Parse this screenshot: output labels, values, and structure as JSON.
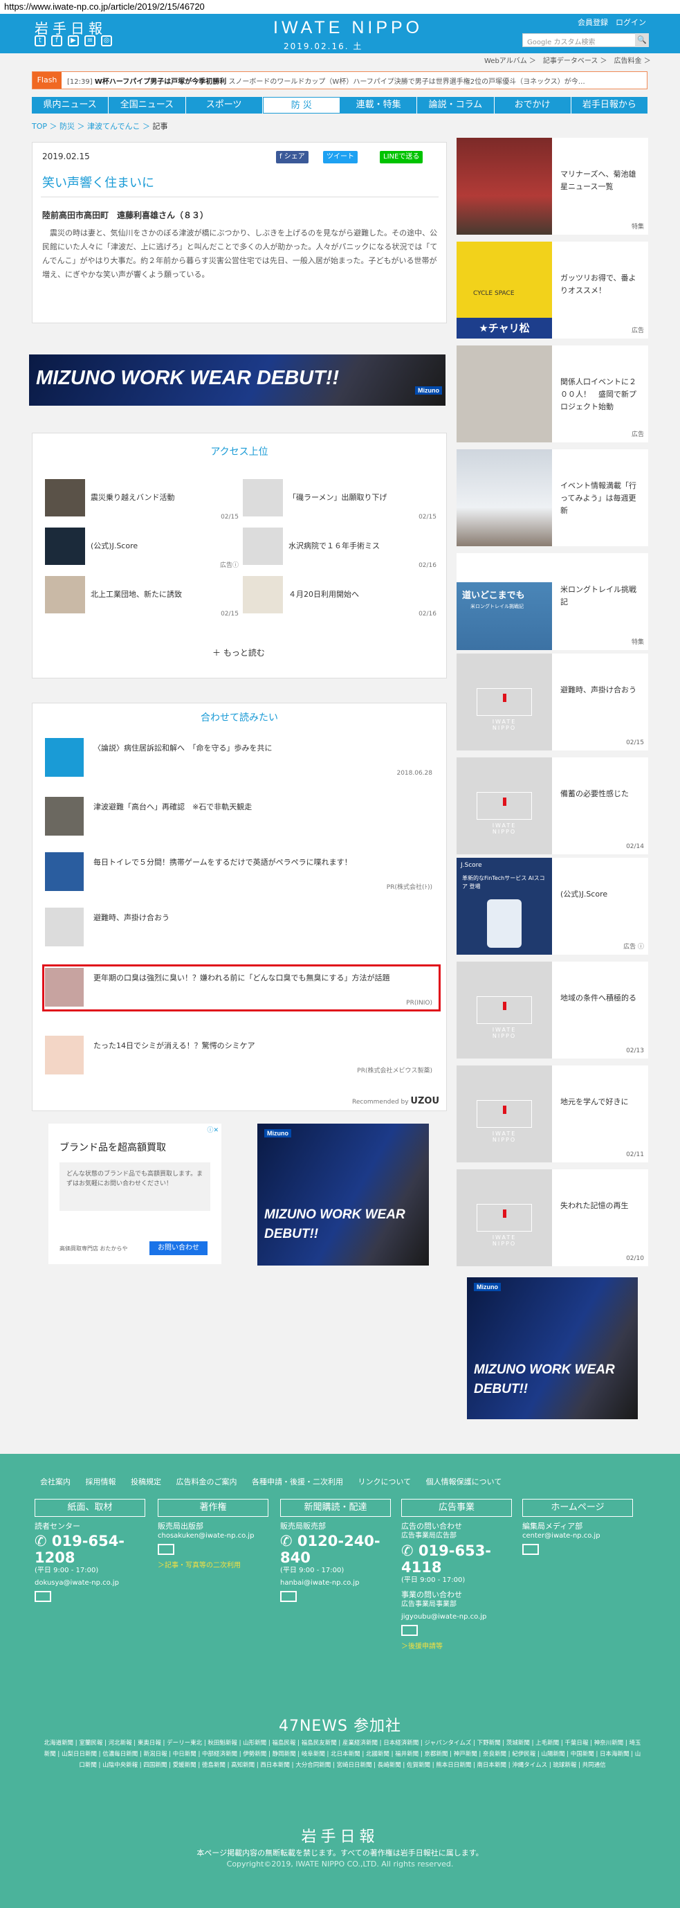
{
  "url": "https://www.iwate-np.co.jp/article/2019/2/15/46720",
  "header": {
    "logo": "岩手日報",
    "brand": "IWATE NIPPO",
    "date": "2019.02.16. 土",
    "links": "会員登録　ログイン",
    "search_placeholder": "Google カスタム検索",
    "search_btn": "🔍"
  },
  "toplinks": "Webアルバム ＞　記事データベース ＞　広告料金 ＞",
  "flash": {
    "label": "Flash",
    "time": "[12:39]",
    "headline": "W杯ハーフパイプ男子は戸塚が今季初勝利",
    "text": "スノーボードのワールドカップ（W杯）ハーフパイプ決勝で男子は世界選手権2位の戸塚優斗（ヨネックス）が今…"
  },
  "nav": [
    "県内ニュース",
    "全国ニュース",
    "スポーツ",
    "防 災",
    "連載・特集",
    "論説・コラム",
    "おでかけ",
    "岩手日報から"
  ],
  "breadcrumb": {
    "a": "TOP",
    "b": "防災",
    "c": "津波てんでんこ",
    "d": "記事",
    "sep": " ＞ "
  },
  "article": {
    "date": "2019.02.15",
    "share_fb": "f シェア",
    "share_tw": "ツイート",
    "share_line": "LINEで送る",
    "title": "笑い声響く住まいに",
    "author": "陸前高田市高田町　遠藤利喜雄さん（８３）",
    "body": "　震災の時は妻と、気仙川をさかのぼる津波が橋にぶつかり、しぶきを上げるのを見ながら避難した。その途中、公民館にいた人々に「津波だ、上に逃げろ」と叫んだことで多くの人が助かった。人々がパニックになる状況では「てんでんこ」がやはり大事だ。約２年前から暮らす災害公営住宅では先日、一般入居が始まった。子どもがいる世帯が増え、にぎやかな笑い声が響くよう願っている。"
  },
  "ad_banner_text": "MIZUNO WORK WEAR DEBUT!!",
  "mizuno_logo": "Mizuno",
  "ranking": {
    "title": "アクセス上位",
    "items": [
      {
        "title": "震災乗り越えバンド活動",
        "date": "02/15"
      },
      {
        "title": "「磯ラーメン」出願取り下げ",
        "date": "02/15"
      },
      {
        "title": "(公式)J.Score",
        "date": "広告ⓘ"
      },
      {
        "title": "水沢病院で１６年手術ミス",
        "date": "02/16"
      },
      {
        "title": "北上工業団地、新たに誘致",
        "date": "02/15"
      },
      {
        "title": "４月20日利用開始へ",
        "date": "02/16"
      }
    ],
    "more": "もっと読む"
  },
  "recommend": {
    "title": "合わせて読みたい",
    "items": [
      {
        "title": "〈論説〉病住居訴訟和解へ　「命を守る」歩みを共に",
        "meta": "2018.06.28"
      },
      {
        "title": "津波避難「高台へ」再確認　※石で非軌天観走",
        "meta": ""
      },
      {
        "title": "毎日トイレで５分間！携帯ゲームをするだけで英語がペラペラに喋れます！",
        "meta": "PR(株式会社(ﾄ))"
      },
      {
        "title": "避難時、声掛け合おう",
        "meta": ""
      },
      {
        "title": "更年期の口臭は強烈に臭い！？嫌われる前に「どんな口臭でも無臭にする」方法が話題",
        "meta": "PR(INIO)"
      },
      {
        "title": "たった14日でシミが消える！？驚愕のシミケア",
        "meta": "PR(株式会社メビウス製薬)"
      }
    ],
    "recommended_by": "Recommended by",
    "uzou": "UZOU"
  },
  "brand_ad": {
    "title": "ブランド品を超高額買取",
    "desc": "どんな状態のブランド品でも高額買取します。まずはお気軽にお問い合わせください！",
    "footer": "高価買取専門店 おたからや",
    "button": "お問い合わせ",
    "adchoices": "ⓘ✕"
  },
  "sidebar": [
    {
      "title": "マリナーズへ、菊池雄星ニュース一覧",
      "tag": "特集"
    },
    {
      "title": "ガッツリお得で、番よりオススメ！",
      "tag": "広告"
    },
    {
      "title": "関係人口イベントに２００人！　盛岡で新プロジェクト始動",
      "tag": "広告"
    },
    {
      "title": "イベント情報満載「行ってみよう」は毎週更新",
      "tag": ""
    },
    {
      "title": "米ロングトレイル挑戦記",
      "tag": "特集"
    },
    {
      "title": "避難時、声掛け合おう",
      "tag": "02/15"
    },
    {
      "title": "備蓄の必要性感じた",
      "tag": "02/14"
    },
    {
      "title": "(公式)J.Score",
      "tag": "広告 ⓘ"
    },
    {
      "title": "地域の条件へ積極的る",
      "tag": "02/13"
    },
    {
      "title": "地元を学んで好きに",
      "tag": "02/11"
    },
    {
      "title": "失われた記憶の再生",
      "tag": "02/10"
    }
  ],
  "sidebar_img_text": {
    "chari": "★チャリ松",
    "cycle": "CYCLE SPACE",
    "trail": "道いどこまでも",
    "trail_sub": "米ロングトレイル挑戦記",
    "iwate1": "IWATE",
    "iwate2": "NIPPO",
    "jscore": "J.Score",
    "jscore_sub": "革新的なFinTechサービス AIスコア 登場"
  },
  "footer": {
    "links": "会社案内 採用情報 投稿規定 広告料金のご案内 各種申請・後援・二次利用 リンクについて 個人情報保護について",
    "cols": [
      {
        "head": "紙面、取材",
        "l1": "読者センター",
        "big": "019-654-1208",
        "hours": "(平日 9:00 - 17:00)",
        "mail": "dokusya@iwate-np.co.jp"
      },
      {
        "head": "著作権",
        "l1": "販売局出版部",
        "mail": "chosakuken@iwate-np.co.jp",
        "yel": "＞記事・写真等の二次利用"
      },
      {
        "head": "新聞購読・配達",
        "l1": "販売局販売部",
        "big": "0120-240-840",
        "hours": "(平日 9:00 - 17:00)",
        "mail": "hanbai@iwate-np.co.jp"
      },
      {
        "head": "広告事業",
        "l1": "広告の問い合わせ",
        "l2": "広告事業局広告部",
        "big": "019-653-4118",
        "hours": "(平日 9:00 - 17:00)",
        "l3": "事業の問い合わせ",
        "l4": "広告事業局事業部",
        "mail": "jigyoubu@iwate-np.co.jp",
        "yel": "＞後援申請等"
      },
      {
        "head": "ホームページ",
        "l1": "編集局メディア部",
        "mail": "center@iwate-np.co.jp"
      }
    ],
    "news47": "47NEWS 参加社",
    "papers": "北海道新聞 | 室蘭民報 | 河北新報 | 東奥日報 | デーリー東北 | 秋田魁新報 | 山形新聞 | 福島民報 | 福島民友新聞 | 産業経済新聞 | 日本経済新聞 | ジャパンタイムズ | 下野新聞 | 茨城新聞 | 上毛新聞 | 千葉日報 | 神奈川新聞 | 埼玉新聞 | 山梨日日新聞 | 信濃毎日新聞 | 新潟日報 | 中日新聞 | 中部経済新聞 | 伊勢新聞 | 静岡新聞 | 岐阜新聞 | 北日本新聞 | 北國新聞 | 福井新聞 | 京都新聞 | 神戸新聞 | 奈良新聞 | 紀伊民報 | 山陽新聞 | 中国新聞 | 日本海新聞 | 山口新聞 | 山陰中央新報 | 四国新聞 | 愛媛新聞 | 徳島新聞 | 高知新聞 | 西日本新聞 | 大分合同新聞 | 宮崎日日新聞 | 長崎新聞 | 佐賀新聞 | 熊本日日新聞 | 南日本新聞 | 沖縄タイムス | 琉球新報 | 共同通信",
    "logo": "岩手日報",
    "note": "本ページ掲載内容の無断転載を禁じます。すべての著作権は岩手日報社に属します。",
    "copy": "Copyright©2019, IWATE NIPPO CO.,LTD. All rights reserved."
  }
}
